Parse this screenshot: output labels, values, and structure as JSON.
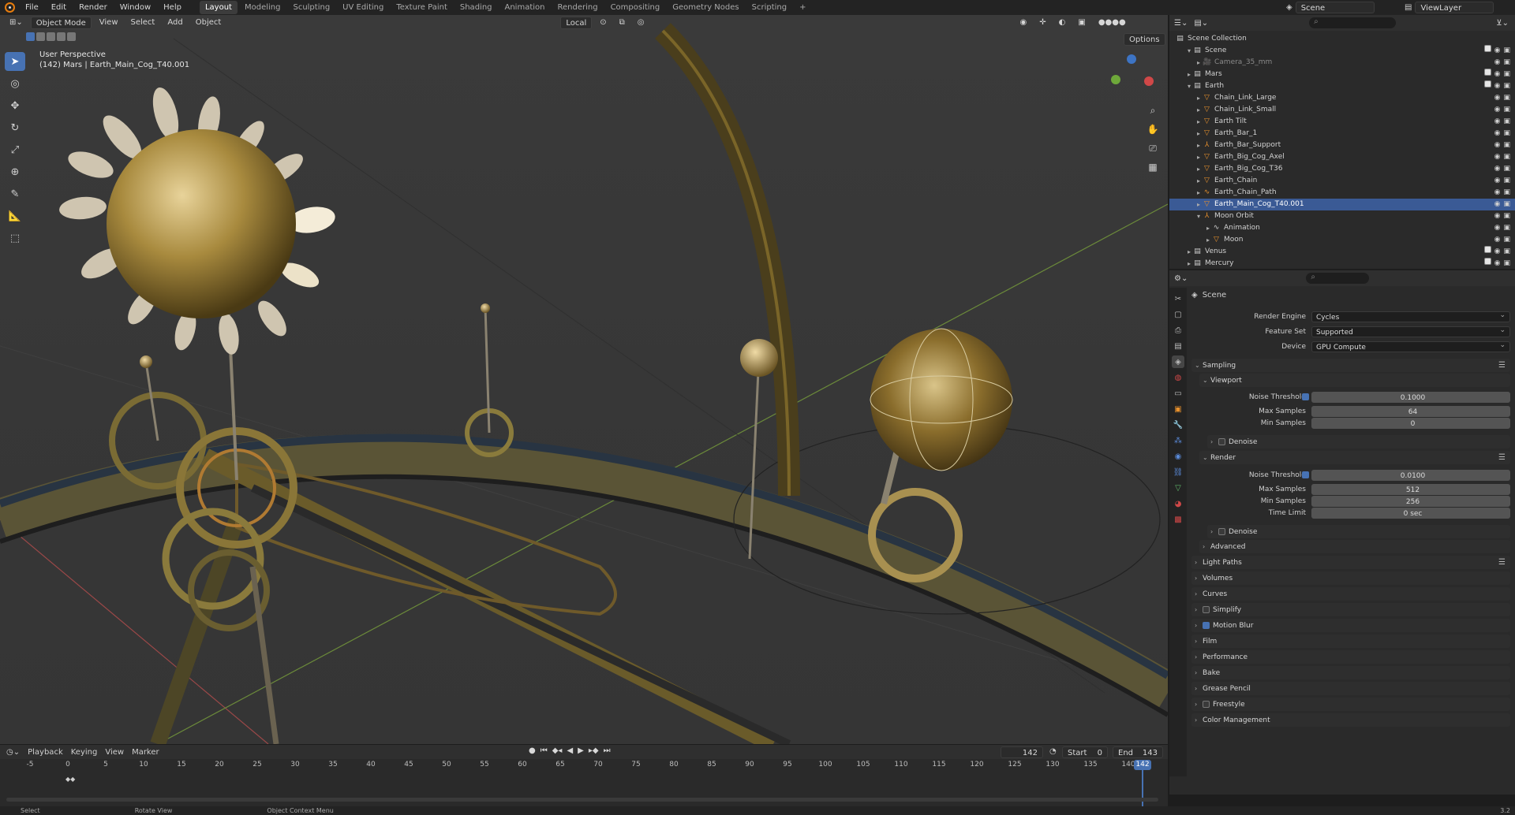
{
  "topbar": {
    "menus": [
      "File",
      "Edit",
      "Render",
      "Window",
      "Help"
    ],
    "workspaces": [
      "Layout",
      "Modeling",
      "Sculpting",
      "UV Editing",
      "Texture Paint",
      "Shading",
      "Animation",
      "Rendering",
      "Compositing",
      "Geometry Nodes",
      "Scripting"
    ],
    "active_workspace": "Layout",
    "add_tab": "+",
    "scene": "Scene",
    "view_layer": "ViewLayer"
  },
  "viewport": {
    "mode": "Object Mode",
    "menus": [
      "View",
      "Select",
      "Add",
      "Object"
    ],
    "orientation": "Local",
    "options": "Options",
    "perspective": "User Perspective",
    "active_object_info": "(142) Mars | Earth_Main_Cog_T40.001"
  },
  "outliner": {
    "root": "Scene Collection",
    "rows": [
      {
        "label": "Scene",
        "indent": 1,
        "expanded": true,
        "icon": "collection-icon"
      },
      {
        "label": "Camera_35_mm",
        "indent": 2,
        "dim": true,
        "icon": "camera-icon"
      },
      {
        "label": "Mars",
        "indent": 1,
        "icon": "collection-icon"
      },
      {
        "label": "Earth",
        "indent": 1,
        "expanded": true,
        "icon": "collection-icon"
      },
      {
        "label": "Chain_Link_Large",
        "indent": 2,
        "icon": "mesh-icon"
      },
      {
        "label": "Chain_Link_Small",
        "indent": 2,
        "icon": "mesh-icon"
      },
      {
        "label": "Earth Tilt",
        "indent": 2,
        "icon": "mesh-icon"
      },
      {
        "label": "Earth_Bar_1",
        "indent": 2,
        "icon": "mesh-icon"
      },
      {
        "label": "Earth_Bar_Support",
        "indent": 2,
        "icon": "empty-icon"
      },
      {
        "label": "Earth_Big_Cog_Axel",
        "indent": 2,
        "icon": "mesh-icon"
      },
      {
        "label": "Earth_Big_Cog_T36",
        "indent": 2,
        "icon": "mesh-icon"
      },
      {
        "label": "Earth_Chain",
        "indent": 2,
        "icon": "mesh-icon"
      },
      {
        "label": "Earth_Chain_Path",
        "indent": 2,
        "icon": "curve-icon"
      },
      {
        "label": "Earth_Main_Cog_T40.001",
        "indent": 2,
        "selected": true,
        "icon": "mesh-icon"
      },
      {
        "label": "Moon Orbit",
        "indent": 2,
        "expanded": true,
        "icon": "empty-icon"
      },
      {
        "label": "Animation",
        "indent": 3,
        "icon": "animation-icon"
      },
      {
        "label": "Moon",
        "indent": 3,
        "icon": "mesh-icon"
      },
      {
        "label": "Venus",
        "indent": 1,
        "icon": "collection-icon"
      },
      {
        "label": "Mercury",
        "indent": 1,
        "icon": "collection-icon"
      }
    ]
  },
  "properties": {
    "context": "Scene",
    "render_engine_label": "Render Engine",
    "render_engine": "Cycles",
    "feature_set_label": "Feature Set",
    "feature_set": "Supported",
    "device_label": "Device",
    "device": "GPU Compute",
    "sampling": "Sampling",
    "viewport": "Viewport",
    "noise_threshold_label": "Noise Threshold",
    "vp_noise_threshold": "0.1000",
    "max_samples_label": "Max Samples",
    "vp_max_samples": "64",
    "min_samples_label": "Min Samples",
    "vp_min_samples": "0",
    "denoise": "Denoise",
    "render": "Render",
    "r_noise_threshold": "0.0100",
    "r_max_samples": "512",
    "r_min_samples": "256",
    "time_limit_label": "Time Limit",
    "r_time_limit": "0 sec",
    "advanced": "Advanced",
    "light_paths": "Light Paths",
    "volumes": "Volumes",
    "curves": "Curves",
    "simplify": "Simplify",
    "motion_blur": "Motion Blur",
    "film": "Film",
    "performance": "Performance",
    "bake": "Bake",
    "grease_pencil": "Grease Pencil",
    "freestyle": "Freestyle",
    "color_management": "Color Management"
  },
  "timeline": {
    "menus": [
      "Playback",
      "Keying",
      "View",
      "Marker"
    ],
    "current_frame": "142",
    "start_label": "Start",
    "start": "0",
    "end_label": "End",
    "end": "143",
    "ticks": [
      "-5",
      "0",
      "5",
      "10",
      "15",
      "20",
      "25",
      "30",
      "35",
      "40",
      "45",
      "50",
      "55",
      "60",
      "65",
      "70",
      "75",
      "80",
      "85",
      "90",
      "95",
      "100",
      "105",
      "110",
      "115",
      "120",
      "125",
      "130",
      "135",
      "140"
    ],
    "playhead": "142"
  },
  "statusbar": {
    "select": "Select",
    "rotate": "Rotate View",
    "context": "Object Context Menu",
    "version": "3.2"
  },
  "colors": {
    "accent": "#4772b3",
    "selection": "#3a5a95",
    "brass": "#b08c3c"
  }
}
